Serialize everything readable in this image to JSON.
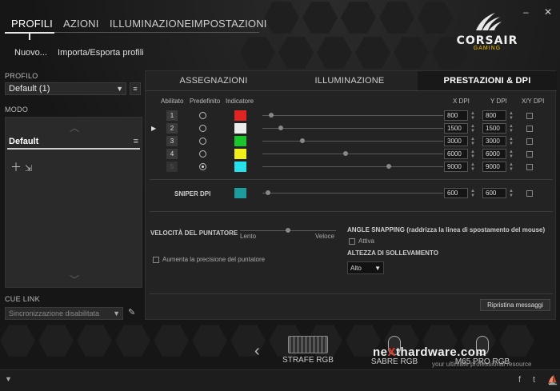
{
  "nav": {
    "tabs": [
      "PROFILI",
      "AZIONI",
      "ILLUMINAZIONE",
      "IMPOSTAZIONI"
    ],
    "active": "PROFILI"
  },
  "window": {
    "minimize": "–",
    "close": "✕"
  },
  "brand": {
    "name": "CORSAIR",
    "sub": "GAMING"
  },
  "profile_actions": {
    "new": "Nuovo...",
    "import_export": "Importa/Esporta profili"
  },
  "profile": {
    "label": "PROFILO",
    "selected": "Default (1)"
  },
  "mode": {
    "label": "MODO",
    "items": [
      "Default"
    ]
  },
  "cue_link": {
    "label": "CUE LINK",
    "selected": "Sincronizzazione disabilitata"
  },
  "main": {
    "tabs": [
      "ASSEGNAZIONI",
      "ILLUMINAZIONE",
      "PRESTAZIONI & DPI"
    ],
    "active_tab": "PRESTAZIONI & DPI",
    "columns": {
      "enabled": "Abilitato",
      "default": "Predefinito",
      "indicator": "Indicatore",
      "xdpi": "X DPI",
      "ydpi": "Y DPI",
      "xy": "X/Y DPI"
    },
    "dpi_rows": [
      {
        "n": "1",
        "color": "#e02424",
        "x": "800",
        "y": "800",
        "pos": 0.05,
        "default": false,
        "enabled": true,
        "current": false
      },
      {
        "n": "2",
        "color": "#ececec",
        "x": "1500",
        "y": "1500",
        "pos": 0.1,
        "default": false,
        "enabled": true,
        "current": true
      },
      {
        "n": "3",
        "color": "#19c52a",
        "x": "3000",
        "y": "3000",
        "pos": 0.22,
        "default": false,
        "enabled": true,
        "current": false
      },
      {
        "n": "4",
        "color": "#f1ef1a",
        "x": "6000",
        "y": "6000",
        "pos": 0.46,
        "default": false,
        "enabled": true,
        "current": false
      },
      {
        "n": "5",
        "color": "#26e0ea",
        "x": "9000",
        "y": "9000",
        "pos": 0.7,
        "default": true,
        "enabled": false,
        "current": false
      }
    ],
    "sniper": {
      "label": "SNIPER DPI",
      "color": "#1e9c9c",
      "x": "600",
      "y": "600",
      "pos": 0.03
    },
    "pointer": {
      "title": "VELOCITÀ DEL PUNTATORE",
      "slow": "Lento",
      "fast": "Veloce",
      "pos": 0.5,
      "precision": "Aumenta la precisione del puntatore"
    },
    "angle": {
      "title": "ANGLE SNAPPING (raddrizza la linea di spostamento del mouse)",
      "active": "Attiva"
    },
    "lift": {
      "title": "ALTEZZA DI SOLLEVAMENTO",
      "selected": "Alto"
    },
    "reset": "Ripristina messaggi"
  },
  "devices": [
    {
      "name": "STRAFE RGB"
    },
    {
      "name": "SABRE RGB"
    },
    {
      "name": "M65 PRO RGB"
    }
  ],
  "watermark": {
    "pre": "ne",
    "accent": "X",
    "post": "thardware.com",
    "sub": "your ultimate professional resource"
  },
  "social": [
    "f",
    "t"
  ]
}
